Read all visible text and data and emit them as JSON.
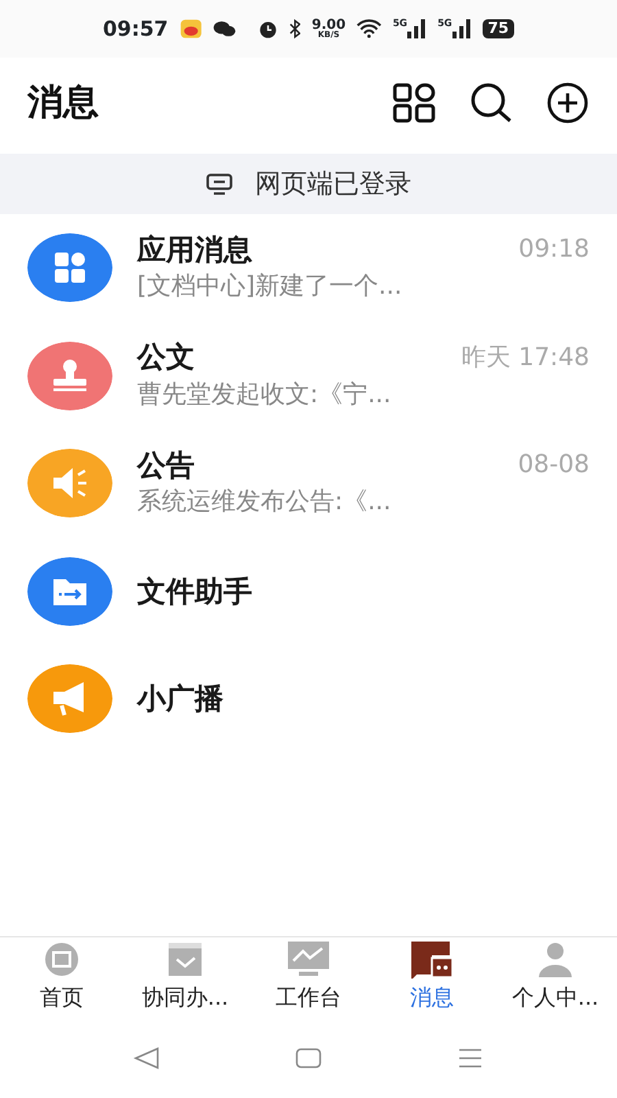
{
  "status_bar": {
    "time": "09:57",
    "speed": "9.00",
    "speed_unit": "KB/S",
    "network_1": "5G",
    "network_2": "5G",
    "battery": "75"
  },
  "header": {
    "title": "消息"
  },
  "banner": {
    "text": "网页端已登录"
  },
  "conversations": [
    {
      "kind": "apps",
      "color": "#2a7ff0",
      "title": "应用消息",
      "time": "09:18",
      "preview": "[文档中心]新建了一个..."
    },
    {
      "kind": "stamp",
      "color": "#f07474",
      "title": "公文",
      "time": "昨天 17:48",
      "preview": "曹先堂发起收文:《宁..."
    },
    {
      "kind": "speaker",
      "color": "#f8a524",
      "title": "公告",
      "time": "08-08",
      "preview": "系统运维发布公告:《..."
    },
    {
      "kind": "folder",
      "color": "#2a7ff0",
      "title": "文件助手"
    },
    {
      "kind": "megaphone",
      "color": "#f7990c",
      "title": "小广播"
    }
  ],
  "tabs": [
    {
      "kind": "home",
      "label": "首页",
      "selected": false
    },
    {
      "kind": "tasks",
      "label": "协同办...",
      "selected": false
    },
    {
      "kind": "desk",
      "label": "工作台",
      "selected": false
    },
    {
      "kind": "chat",
      "label": "消息",
      "selected": true
    },
    {
      "kind": "person",
      "label": "个人中...",
      "selected": false
    }
  ]
}
